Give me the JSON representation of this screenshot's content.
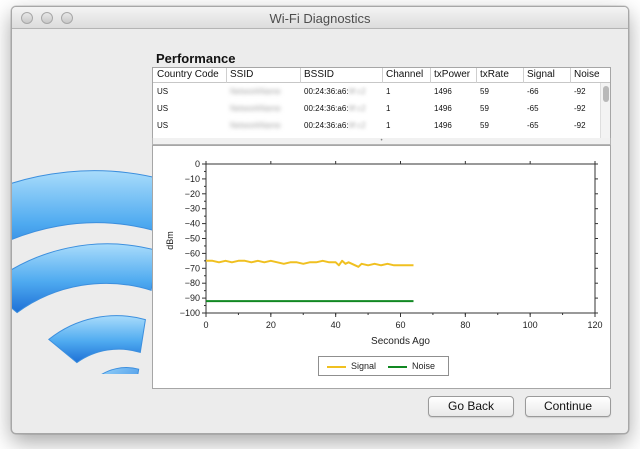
{
  "window": {
    "title": "Wi-Fi Diagnostics"
  },
  "section_title": "Performance",
  "table": {
    "columns": [
      "Country Code",
      "SSID",
      "BSSID",
      "Channel",
      "txPower",
      "txRate",
      "Signal",
      "Noise"
    ],
    "rows": [
      {
        "country": "US",
        "ssid": "NetworkName",
        "bssid": "00:24:36:a6:",
        "bssid_tail": "9f:c2",
        "channel": "1",
        "txpower": "1496",
        "txrate": "59",
        "signal": "-66",
        "noise": "-92"
      },
      {
        "country": "US",
        "ssid": "NetworkName",
        "bssid": "00:24:36:a6:",
        "bssid_tail": "9f:c2",
        "channel": "1",
        "txpower": "1496",
        "txrate": "59",
        "signal": "-65",
        "noise": "-92"
      },
      {
        "country": "US",
        "ssid": "NetworkName",
        "bssid": "00:24:36:a6:",
        "bssid_tail": "9f:c2",
        "channel": "1",
        "txpower": "1496",
        "txrate": "59",
        "signal": "-65",
        "noise": "-92"
      }
    ]
  },
  "chart_data": {
    "type": "line",
    "xlabel": "Seconds Ago",
    "ylabel": "dBm",
    "xlim": [
      0,
      120
    ],
    "ylim": [
      -100,
      0
    ],
    "xticks": [
      0,
      20,
      40,
      60,
      80,
      100,
      120
    ],
    "yticks": [
      0,
      -10,
      -20,
      -30,
      -40,
      -50,
      -60,
      -70,
      -80,
      -90,
      -100
    ],
    "grid": false,
    "legend_position": "bottom",
    "series": [
      {
        "name": "Signal",
        "color": "#f0c020",
        "x": [
          0,
          2,
          4,
          6,
          8,
          10,
          12,
          14,
          16,
          18,
          20,
          22,
          24,
          26,
          28,
          30,
          32,
          34,
          36,
          38,
          40,
          41,
          42,
          43,
          44,
          45,
          46,
          47,
          48,
          50,
          52,
          54,
          56,
          58,
          60,
          62,
          64
        ],
        "y": [
          -65,
          -65,
          -66,
          -65,
          -66,
          -65,
          -65,
          -66,
          -65,
          -66,
          -65,
          -66,
          -67,
          -66,
          -66,
          -67,
          -66,
          -66,
          -65,
          -66,
          -66,
          -68,
          -65,
          -67,
          -66,
          -67,
          -68,
          -69,
          -67,
          -68,
          -67,
          -68,
          -67,
          -68,
          -68,
          -68,
          -68
        ]
      },
      {
        "name": "Noise",
        "color": "#118822",
        "x": [
          0,
          64
        ],
        "y": [
          -92,
          -92
        ]
      }
    ]
  },
  "buttons": {
    "go_back": "Go Back",
    "continue": "Continue"
  }
}
